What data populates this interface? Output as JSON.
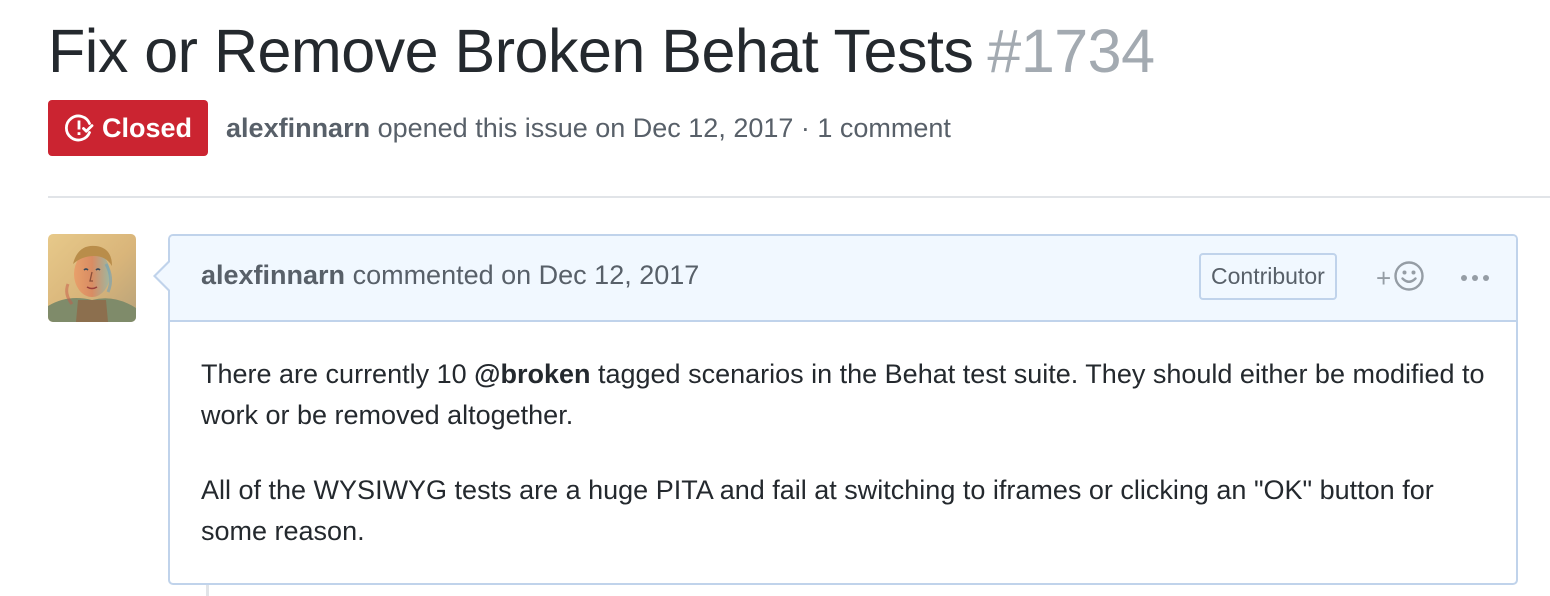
{
  "issue": {
    "title": "Fix or Remove Broken Behat Tests",
    "number": "#1734",
    "state": "Closed",
    "state_color": "#cb2431",
    "author": "alexfinnarn",
    "opened_text": "opened this issue on Dec 12, 2017 · 1 comment"
  },
  "comment": {
    "author": "alexfinnarn",
    "date_text": "commented on Dec 12, 2017",
    "role": "Contributor",
    "reaction_plus": "+",
    "body": {
      "p1_before": "There are currently 10 ",
      "p1_mention": "@broken",
      "p1_after": " tagged scenarios in the Behat test suite. They should either be modified to work or be removed altogether.",
      "p2": "All of the WYSIWYG tests are a huge PITA and fail at switching to iframes or clicking an \"OK\" button for some reason."
    }
  },
  "icons": {
    "state": "issue-closed-icon",
    "reaction": "smiley-icon",
    "more": "kebab-horizontal-icon"
  },
  "colors": {
    "header_bg": "#f1f8ff",
    "border": "#c0d3eb",
    "muted_text": "#586069",
    "number_text": "#a3aab1"
  }
}
